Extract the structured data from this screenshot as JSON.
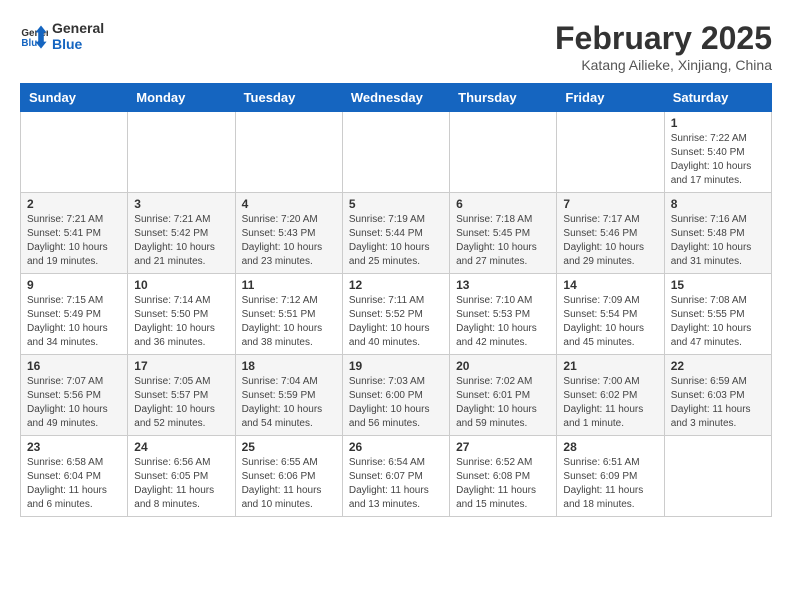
{
  "header": {
    "logo_line1": "General",
    "logo_line2": "Blue",
    "title": "February 2025",
    "subtitle": "Katang Ailieke, Xinjiang, China"
  },
  "days_of_week": [
    "Sunday",
    "Monday",
    "Tuesday",
    "Wednesday",
    "Thursday",
    "Friday",
    "Saturday"
  ],
  "weeks": [
    [
      {
        "day": "",
        "info": ""
      },
      {
        "day": "",
        "info": ""
      },
      {
        "day": "",
        "info": ""
      },
      {
        "day": "",
        "info": ""
      },
      {
        "day": "",
        "info": ""
      },
      {
        "day": "",
        "info": ""
      },
      {
        "day": "1",
        "info": "Sunrise: 7:22 AM\nSunset: 5:40 PM\nDaylight: 10 hours and 17 minutes."
      }
    ],
    [
      {
        "day": "2",
        "info": "Sunrise: 7:21 AM\nSunset: 5:41 PM\nDaylight: 10 hours and 19 minutes."
      },
      {
        "day": "3",
        "info": "Sunrise: 7:21 AM\nSunset: 5:42 PM\nDaylight: 10 hours and 21 minutes."
      },
      {
        "day": "4",
        "info": "Sunrise: 7:20 AM\nSunset: 5:43 PM\nDaylight: 10 hours and 23 minutes."
      },
      {
        "day": "5",
        "info": "Sunrise: 7:19 AM\nSunset: 5:44 PM\nDaylight: 10 hours and 25 minutes."
      },
      {
        "day": "6",
        "info": "Sunrise: 7:18 AM\nSunset: 5:45 PM\nDaylight: 10 hours and 27 minutes."
      },
      {
        "day": "7",
        "info": "Sunrise: 7:17 AM\nSunset: 5:46 PM\nDaylight: 10 hours and 29 minutes."
      },
      {
        "day": "8",
        "info": "Sunrise: 7:16 AM\nSunset: 5:48 PM\nDaylight: 10 hours and 31 minutes."
      }
    ],
    [
      {
        "day": "9",
        "info": "Sunrise: 7:15 AM\nSunset: 5:49 PM\nDaylight: 10 hours and 34 minutes."
      },
      {
        "day": "10",
        "info": "Sunrise: 7:14 AM\nSunset: 5:50 PM\nDaylight: 10 hours and 36 minutes."
      },
      {
        "day": "11",
        "info": "Sunrise: 7:12 AM\nSunset: 5:51 PM\nDaylight: 10 hours and 38 minutes."
      },
      {
        "day": "12",
        "info": "Sunrise: 7:11 AM\nSunset: 5:52 PM\nDaylight: 10 hours and 40 minutes."
      },
      {
        "day": "13",
        "info": "Sunrise: 7:10 AM\nSunset: 5:53 PM\nDaylight: 10 hours and 42 minutes."
      },
      {
        "day": "14",
        "info": "Sunrise: 7:09 AM\nSunset: 5:54 PM\nDaylight: 10 hours and 45 minutes."
      },
      {
        "day": "15",
        "info": "Sunrise: 7:08 AM\nSunset: 5:55 PM\nDaylight: 10 hours and 47 minutes."
      }
    ],
    [
      {
        "day": "16",
        "info": "Sunrise: 7:07 AM\nSunset: 5:56 PM\nDaylight: 10 hours and 49 minutes."
      },
      {
        "day": "17",
        "info": "Sunrise: 7:05 AM\nSunset: 5:57 PM\nDaylight: 10 hours and 52 minutes."
      },
      {
        "day": "18",
        "info": "Sunrise: 7:04 AM\nSunset: 5:59 PM\nDaylight: 10 hours and 54 minutes."
      },
      {
        "day": "19",
        "info": "Sunrise: 7:03 AM\nSunset: 6:00 PM\nDaylight: 10 hours and 56 minutes."
      },
      {
        "day": "20",
        "info": "Sunrise: 7:02 AM\nSunset: 6:01 PM\nDaylight: 10 hours and 59 minutes."
      },
      {
        "day": "21",
        "info": "Sunrise: 7:00 AM\nSunset: 6:02 PM\nDaylight: 11 hours and 1 minute."
      },
      {
        "day": "22",
        "info": "Sunrise: 6:59 AM\nSunset: 6:03 PM\nDaylight: 11 hours and 3 minutes."
      }
    ],
    [
      {
        "day": "23",
        "info": "Sunrise: 6:58 AM\nSunset: 6:04 PM\nDaylight: 11 hours and 6 minutes."
      },
      {
        "day": "24",
        "info": "Sunrise: 6:56 AM\nSunset: 6:05 PM\nDaylight: 11 hours and 8 minutes."
      },
      {
        "day": "25",
        "info": "Sunrise: 6:55 AM\nSunset: 6:06 PM\nDaylight: 11 hours and 10 minutes."
      },
      {
        "day": "26",
        "info": "Sunrise: 6:54 AM\nSunset: 6:07 PM\nDaylight: 11 hours and 13 minutes."
      },
      {
        "day": "27",
        "info": "Sunrise: 6:52 AM\nSunset: 6:08 PM\nDaylight: 11 hours and 15 minutes."
      },
      {
        "day": "28",
        "info": "Sunrise: 6:51 AM\nSunset: 6:09 PM\nDaylight: 11 hours and 18 minutes."
      },
      {
        "day": "",
        "info": ""
      }
    ]
  ]
}
